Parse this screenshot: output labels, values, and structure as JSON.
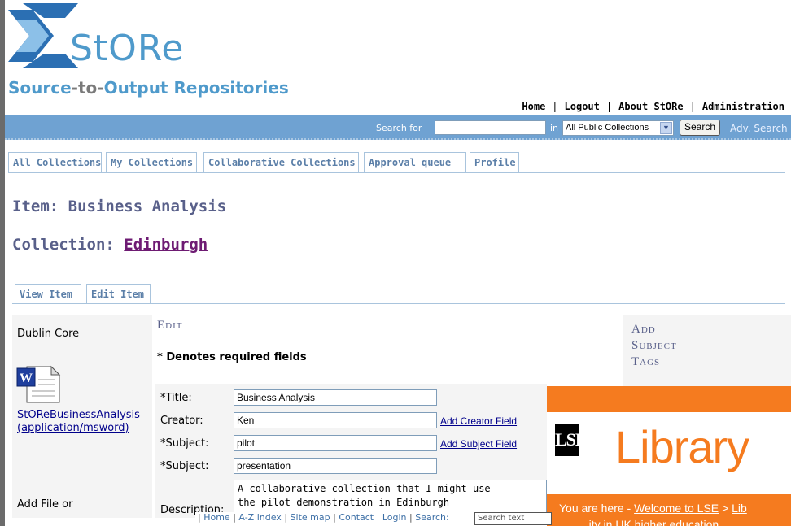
{
  "header": {
    "logo_text": "StORe",
    "tagline_part1": "Source",
    "tagline_dash1": "-to-",
    "tagline_part2": "Output",
    "tagline_part3": " Repositories"
  },
  "topnav": {
    "items": [
      "Home",
      "Logout",
      "About StORe",
      "Administration"
    ],
    "separator": "|"
  },
  "searchbar": {
    "label": "Search for",
    "input_value": "",
    "in_label": "in",
    "scope_selected": "All Public Collections",
    "button_label": "Search",
    "advanced_link": "Adv. Search"
  },
  "tabs": [
    "All Collections",
    "My Collections",
    "Collaborative Collections",
    "Approval queue",
    "Profile"
  ],
  "item_heading_prefix": "Item: ",
  "item_name": "Business Analysis",
  "collection_heading_prefix": "Collection: ",
  "collection_name": "Edinburgh",
  "subtabs": [
    "View Item",
    "Edit Item"
  ],
  "left": {
    "metadata_label": "Dublin Core",
    "file_name": "StOReBusinessAnalysis",
    "file_type": "(application/msword)",
    "add_file_label": "Add File or"
  },
  "edit": {
    "title": "Edit",
    "required_note": "* Denotes required fields",
    "fields": {
      "title_label": "*Title:",
      "title_value": "Business Analysis",
      "creator_label": "Creator:",
      "creator_value": "Ken",
      "creator_link": "Add Creator Field",
      "subject1_label": "*Subject:",
      "subject1_value": "pilot",
      "subject_link": "Add Subject Field",
      "subject2_label": "*Subject:",
      "subject2_value": "presentation",
      "description_label": "Description:",
      "description_value": "A collaborative collection that I might use\nthe pilot demonstration in Edinburgh"
    }
  },
  "right": {
    "lines": [
      "Add",
      "Subject",
      "Tags"
    ]
  },
  "lse": {
    "logo": "LSE",
    "library": "Library",
    "crumb_prefix": "You are here - ",
    "crumb_link": "Welcome to LSE",
    "crumb_sep": " > ",
    "crumb_tail": "Lib",
    "cut_text": "...ity in UK higher education..."
  },
  "bottom": {
    "links": [
      "Home",
      "A-Z index",
      "Site map",
      "Contact",
      "Login"
    ],
    "search_label": "Search:",
    "search_placeholder": "Search text"
  },
  "colors": {
    "accent_blue": "#4f9acb",
    "bar_blue": "#6fa2d2",
    "heading": "#59608a",
    "collection_link": "#6e1b73",
    "lse_orange": "#f57b1f"
  }
}
